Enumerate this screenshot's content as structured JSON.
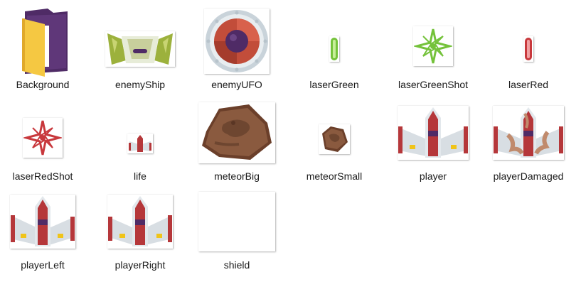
{
  "files": [
    {
      "name": "Background",
      "icon": "folder-icon"
    },
    {
      "name": "enemyShip",
      "icon": "enemy-ship-icon"
    },
    {
      "name": "enemyUFO",
      "icon": "enemy-ufo-icon"
    },
    {
      "name": "laserGreen",
      "icon": "laser-green-icon"
    },
    {
      "name": "laserGreenShot",
      "icon": "laser-green-shot-icon"
    },
    {
      "name": "laserRed",
      "icon": "laser-red-icon"
    },
    {
      "name": "laserRedShot",
      "icon": "laser-red-shot-icon"
    },
    {
      "name": "life",
      "icon": "life-ship-icon"
    },
    {
      "name": "meteorBig",
      "icon": "meteor-big-icon"
    },
    {
      "name": "meteorSmall",
      "icon": "meteor-small-icon"
    },
    {
      "name": "player",
      "icon": "player-ship-icon"
    },
    {
      "name": "playerDamaged",
      "icon": "player-damaged-icon"
    },
    {
      "name": "playerLeft",
      "icon": "player-left-icon"
    },
    {
      "name": "playerRight",
      "icon": "player-right-icon"
    },
    {
      "name": "shield",
      "icon": "shield-icon"
    }
  ],
  "colors": {
    "folder_yellow": "#f5c842",
    "folder_purple": "#4f2b66",
    "ship_red": "#b5373a",
    "ship_grey": "#d8dee3",
    "enemy_green": "#9cb13c",
    "laser_green": "#74c23a",
    "laser_red": "#c8383c",
    "meteor_brown": "#8a5a3f"
  }
}
